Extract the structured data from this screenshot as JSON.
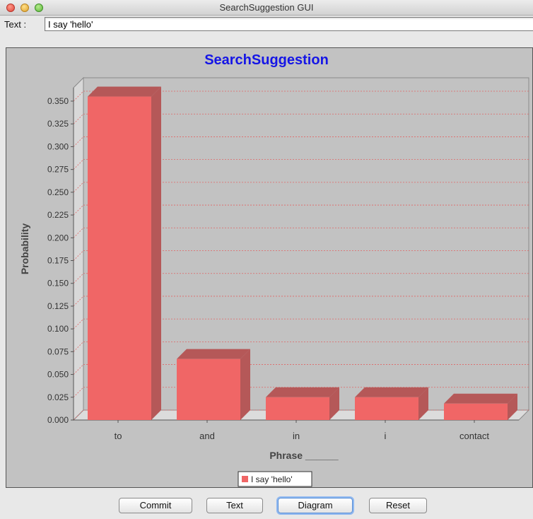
{
  "window": {
    "title": "SearchSuggestion GUI"
  },
  "input": {
    "label": "Text :",
    "value": "I say 'hello'"
  },
  "chart_data": {
    "type": "bar",
    "title": "SearchSuggestion",
    "xlabel": "Phrase ______",
    "ylabel": "Probability",
    "categories": [
      "to",
      "and",
      "in",
      "i",
      "contact"
    ],
    "series": [
      {
        "name": "I say 'hello'",
        "values": [
          0.355,
          0.067,
          0.025,
          0.025,
          0.018
        ]
      }
    ],
    "ylim": [
      0,
      0.355
    ],
    "yticks": [
      "0.000",
      "0.025",
      "0.050",
      "0.075",
      "0.100",
      "0.125",
      "0.150",
      "0.175",
      "0.200",
      "0.225",
      "0.250",
      "0.275",
      "0.300",
      "0.325",
      "0.350"
    ],
    "grid": true,
    "legend": "bottom-center",
    "bar_color": "#f06666",
    "bar_side_color": "#b55858",
    "grid_color": "#e06666",
    "title_color": "#1515e6"
  },
  "buttons": {
    "commit": "Commit",
    "text": "Text",
    "diagram": "Diagram",
    "reset": "Reset"
  }
}
